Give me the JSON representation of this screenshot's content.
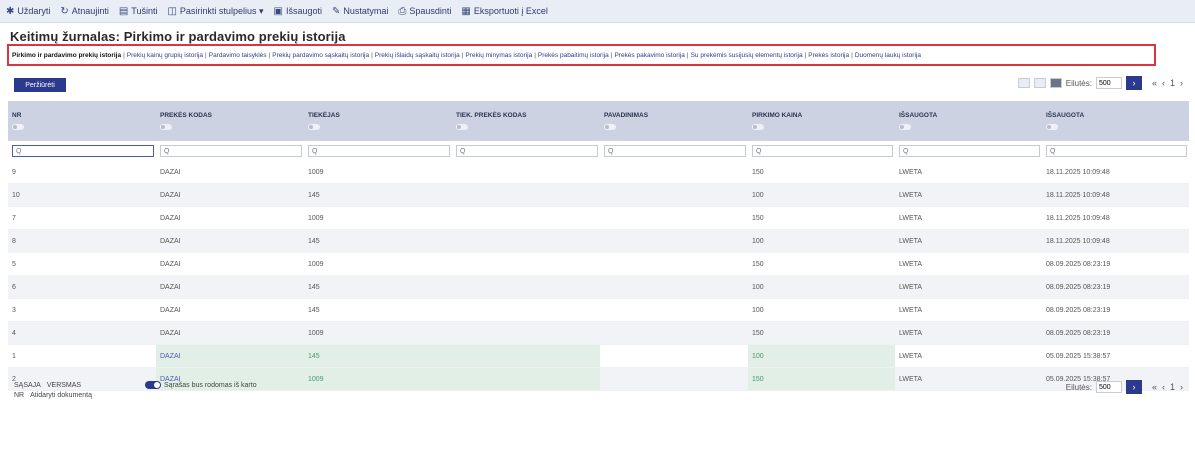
{
  "toolbar": {
    "items": [
      {
        "icon": "save-icon",
        "glyph": "✱",
        "label": "Uždaryti"
      },
      {
        "icon": "refresh-icon",
        "glyph": "↻",
        "label": "Atnaujinti"
      },
      {
        "icon": "table-icon",
        "glyph": "▤",
        "label": "Tušinti"
      },
      {
        "icon": "columns-icon",
        "glyph": "◫",
        "label": "Pasirinkti stulpelius ▾"
      },
      {
        "icon": "disk-icon",
        "glyph": "▣",
        "label": "Išsaugoti"
      },
      {
        "icon": "wrench-icon",
        "glyph": "✎",
        "label": "Nustatymai"
      },
      {
        "icon": "print-icon",
        "glyph": "⎙",
        "label": "Spausdinti"
      },
      {
        "icon": "excel-icon",
        "glyph": "▦",
        "label": "Eksportuoti į Excel"
      }
    ]
  },
  "page": {
    "title": "Keitimų žurnalas: Pirkimo ir pardavimo prekių istorija"
  },
  "links": [
    "Pirkimo ir pardavimo prekių istorija",
    "Prekių kainų grupių istorija",
    "Pardavimo taisyklės",
    "Prekių pardavimo sąskaitų istorija",
    "Prekių išlaidų sąskaitų istorija",
    "Prekių minymas istorija",
    "Prekės pabaitimų istorija",
    "Prekės pakavimo istorija",
    "Su prekėmis susijusių elementų istorija",
    "Prekės istorija",
    "Duomenų laukų istorija"
  ],
  "controls": {
    "view_button": "Peržiūrėti",
    "rows_label": "Eilutės:",
    "rows_value": "500",
    "go": "›",
    "pager": [
      "«",
      "‹",
      "1",
      "›"
    ]
  },
  "table": {
    "columns": [
      "NR",
      "PREKĖS KODAS",
      "TIEKĖJAS",
      "TIEK. PREKĖS KODAS",
      "PAVADINIMAS",
      "PIRKIMO KAINA",
      "IŠSAUGOTA",
      "IŠSAUGOTA"
    ],
    "filter_placeholder": "Q",
    "rows": [
      {
        "nr": "9",
        "code": "DAZAI",
        "supplier": "1009",
        "sup_code": "",
        "name": "",
        "price": "150",
        "saved_by": "LWETA",
        "saved_at": "18.11.2025 10:09:48",
        "hl": false
      },
      {
        "nr": "10",
        "code": "DAZAI",
        "supplier": "145",
        "sup_code": "",
        "name": "",
        "price": "100",
        "saved_by": "LWETA",
        "saved_at": "18.11.2025 10:09:48",
        "hl": false
      },
      {
        "nr": "7",
        "code": "DAZAI",
        "supplier": "1009",
        "sup_code": "",
        "name": "",
        "price": "150",
        "saved_by": "LWETA",
        "saved_at": "18.11.2025 10:09:48",
        "hl": false
      },
      {
        "nr": "8",
        "code": "DAZAI",
        "supplier": "145",
        "sup_code": "",
        "name": "",
        "price": "100",
        "saved_by": "LWETA",
        "saved_at": "18.11.2025 10:09:48",
        "hl": false
      },
      {
        "nr": "5",
        "code": "DAZAI",
        "supplier": "1009",
        "sup_code": "",
        "name": "",
        "price": "150",
        "saved_by": "LWETA",
        "saved_at": "08.09.2025 08:23:19",
        "hl": false
      },
      {
        "nr": "6",
        "code": "DAZAI",
        "supplier": "145",
        "sup_code": "",
        "name": "",
        "price": "100",
        "saved_by": "LWETA",
        "saved_at": "08.09.2025 08:23:19",
        "hl": false
      },
      {
        "nr": "3",
        "code": "DAZAI",
        "supplier": "145",
        "sup_code": "",
        "name": "",
        "price": "100",
        "saved_by": "LWETA",
        "saved_at": "08.09.2025 08:23:19",
        "hl": false
      },
      {
        "nr": "4",
        "code": "DAZAI",
        "supplier": "1009",
        "sup_code": "",
        "name": "",
        "price": "150",
        "saved_by": "LWETA",
        "saved_at": "08.09.2025 08:23:19",
        "hl": false
      },
      {
        "nr": "1",
        "code": "DAZAI",
        "supplier": "145",
        "sup_code": "",
        "name": "",
        "price": "100",
        "saved_by": "LWETA",
        "saved_at": "05.09.2025 15:38:57",
        "hl": true
      },
      {
        "nr": "2",
        "code": "DAZAI",
        "supplier": "1009",
        "sup_code": "",
        "name": "",
        "price": "150",
        "saved_by": "LWETA",
        "saved_at": "05.09.2025 15:38:57",
        "hl": true
      }
    ]
  },
  "footer": {
    "left_row1": [
      "SĄSAJA",
      "VERSMAS"
    ],
    "left_row2": [
      "NR",
      "Atidaryti dokumentą"
    ],
    "toggle_label": "Sąrašas bus rodomas iš karto"
  },
  "colors": {
    "accent": "#2b3a8c",
    "header_bg": "#ccd2e2",
    "highlight": "#e2efe7",
    "box_border": "#d9363e"
  }
}
